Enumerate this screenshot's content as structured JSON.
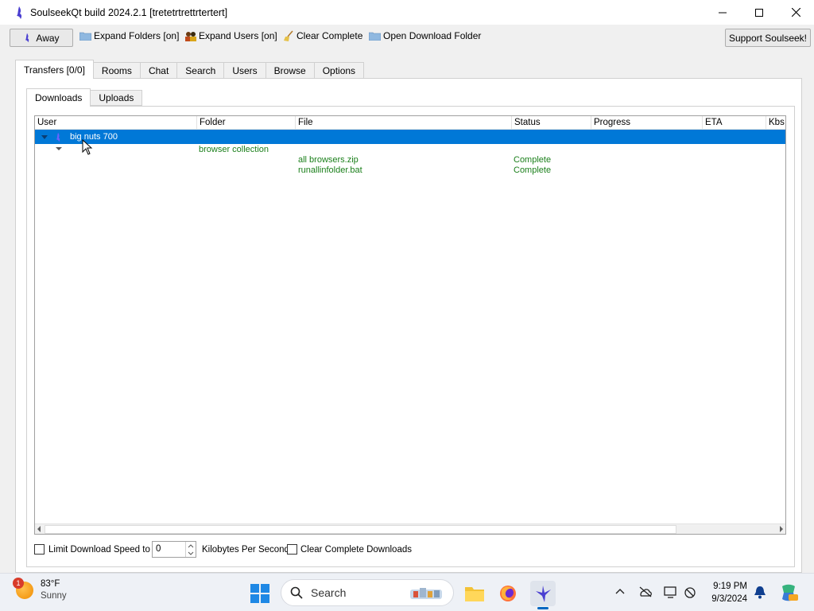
{
  "window": {
    "title": "SoulseekQt build 2024.2.1 [tretetrtrettrtertert]",
    "controls": [
      "minimize",
      "maximize",
      "close"
    ]
  },
  "toolbar": {
    "away": "Away",
    "expand_folders": "Expand Folders [on]",
    "expand_users": "Expand Users [on]",
    "clear_complete": "Clear Complete",
    "open_download_folder": "Open Download Folder",
    "support": "Support Soulseek!"
  },
  "main_tabs": [
    "Transfers [0/0]",
    "Rooms",
    "Chat",
    "Search",
    "Users",
    "Browse",
    "Options"
  ],
  "sub_tabs": [
    "Downloads",
    "Uploads"
  ],
  "columns": [
    "User",
    "Folder",
    "File",
    "Status",
    "Progress",
    "ETA",
    "Kbs"
  ],
  "transfers": {
    "user": "big nuts 700",
    "folder": "browser collection",
    "files": [
      {
        "name": "all browsers.zip",
        "status": "Complete"
      },
      {
        "name": "runallinfolder.bat",
        "status": "Complete"
      }
    ]
  },
  "bottom": {
    "limit_label": "Limit Download Speed to",
    "limit_value": "0",
    "unit_label": "Kilobytes Per Second",
    "clear_label": "Clear Complete Downloads"
  },
  "taskbar": {
    "weather_badge": "1",
    "temperature": "83°F",
    "condition": "Sunny",
    "search_placeholder": "Search",
    "time": "9:19 PM",
    "date": "9/3/2024"
  },
  "colors": {
    "selection": "#0078d7",
    "complete_text": "#1a7f1a",
    "accent": "#0067c0"
  }
}
